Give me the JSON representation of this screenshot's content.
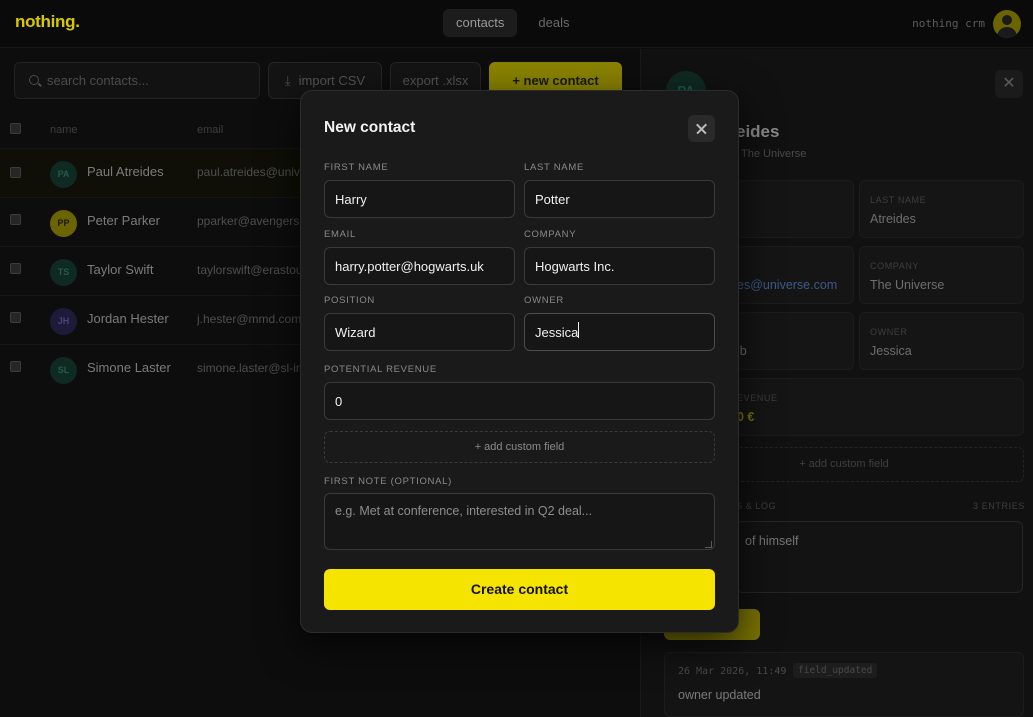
{
  "header": {
    "logo": "nothing.",
    "tabs": [
      {
        "label": "contacts",
        "active": true
      },
      {
        "label": "deals",
        "active": false
      }
    ],
    "brand_right": "nothing crm"
  },
  "toolbar": {
    "search_placeholder": "search contacts...",
    "import_label": "import CSV",
    "export_label": "export .xlsx",
    "new_label": "+ new contact"
  },
  "table": {
    "columns": [
      "name",
      "email"
    ],
    "rows": [
      {
        "initials": "PA",
        "name": "Paul Atreides",
        "email": "paul.atreides@unive",
        "bg": "#0f2a22",
        "fg": "#1f5c4a"
      },
      {
        "initials": "PP",
        "name": "Peter Parker",
        "email": "pparker@avengers.",
        "bg": "#6b6400",
        "fg": "#1a1800"
      },
      {
        "initials": "TS",
        "name": "Taylor Swift",
        "email": "taylorswift@erastou",
        "bg": "#0f2a22",
        "fg": "#1f5c4a"
      },
      {
        "initials": "JH",
        "name": "Jordan Hester",
        "email": "j.hester@mmd.com",
        "bg": "#1e1a3a",
        "fg": "#4a4280"
      },
      {
        "initials": "SL",
        "name": "Simone Laster",
        "email": "simone.laster@sl-in",
        "bg": "#0f2a22",
        "fg": "#1f5c4a"
      }
    ]
  },
  "detail_panel": {
    "avatar": "PA",
    "name_partial": "eides",
    "sub_partial": "The Universe",
    "last_name_label": "LAST NAME",
    "last_name_value": "Atreides",
    "email_partial": "es@universe.com",
    "company_label": "COMPANY",
    "company_value": "The Universe",
    "position_partial": "ib",
    "owner_label": "OWNER",
    "owner_value": "Jessica",
    "revenue_label_partial": "EVENUE",
    "revenue_partial": "0 €",
    "add_custom_field": "+ add custom field",
    "notes_label_partial": "S & LOG",
    "entries": "3 ENTRIES",
    "note_text_partial": "of himself",
    "add_button_partial": "e",
    "log": {
      "timestamp": "26 Mar 2026, 11:49",
      "tag": "field_updated",
      "message": "owner updated"
    }
  },
  "modal": {
    "title": "New contact",
    "fields": {
      "first_name": {
        "label": "FIRST NAME",
        "value": "Harry"
      },
      "last_name": {
        "label": "LAST NAME",
        "value": "Potter"
      },
      "email": {
        "label": "EMAIL",
        "value": "harry.potter@hogwarts.uk"
      },
      "company": {
        "label": "COMPANY",
        "value": "Hogwarts Inc."
      },
      "position": {
        "label": "POSITION",
        "value": "Wizard"
      },
      "owner": {
        "label": "OWNER",
        "value": "Jessica"
      },
      "revenue": {
        "label": "POTENTIAL REVENUE",
        "value": "0"
      }
    },
    "add_custom_field": "+ add custom field",
    "note_label": "FIRST NOTE (OPTIONAL)",
    "note_placeholder": "e.g. Met at conference, interested in Q2 deal...",
    "submit_label": "Create contact"
  },
  "colors": {
    "accent": "#f5e400",
    "background": "#0d0d0d",
    "modal": "#1a1a1a"
  }
}
